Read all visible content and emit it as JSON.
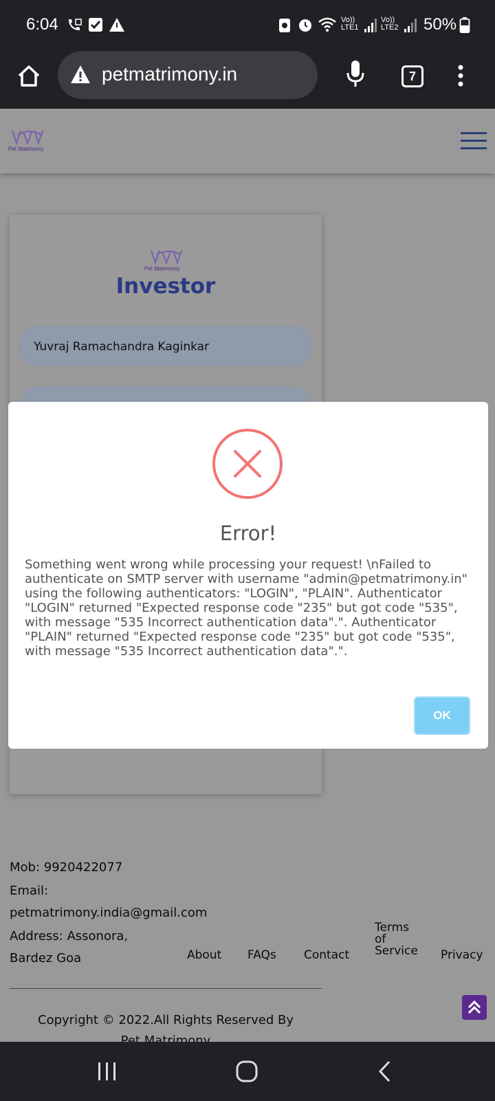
{
  "status_bar": {
    "time": "6:04",
    "battery": "50%",
    "sim1": "LTE1",
    "sim2": "LTE2",
    "volte1": "Vo))",
    "volte2": "Vo))"
  },
  "browser": {
    "url": "petmatrimony.in",
    "tab_count": "7"
  },
  "site": {
    "logo_text": "Pet Matrimony"
  },
  "card": {
    "title": "Investor",
    "name_value": "Yuvraj Ramachandra Kaginkar"
  },
  "modal": {
    "title": "Error!",
    "message": "Something went wrong while processing your request! \\nFailed to authenticate on SMTP server with username \"admin@petmatrimony.in\" using the following authenticators: \"LOGIN\", \"PLAIN\". Authenticator \"LOGIN\" returned \"Expected response code \"235\" but got code \"535\", with message \"535 Incorrect authentication data\".\". Authenticator \"PLAIN\" returned \"Expected response code \"235\" but got code \"535\", with message \"535 Incorrect authentication data\".\".",
    "ok_label": "OK"
  },
  "footer": {
    "mobile": "Mob: 9920422077",
    "email_label": "Email:",
    "email": "petmatrimony.india@gmail.com",
    "address_line1": "Address: Assonora,",
    "address_line2": "Bardez Goa",
    "nav": {
      "about": "About",
      "faqs": "FAQs",
      "contact": "Contact",
      "terms_line1": "Terms",
      "terms_line2": "of",
      "terms_line3": "Service",
      "privacy": "Privacy"
    },
    "copyright_line1": "Copyright © 2022.All Rights Reserved By",
    "copyright_line2": "Pet Matrimony"
  },
  "colors": {
    "modal_ok": "#7ccff5",
    "error_red": "#f27474",
    "brand_blue": "#2a3a86"
  }
}
